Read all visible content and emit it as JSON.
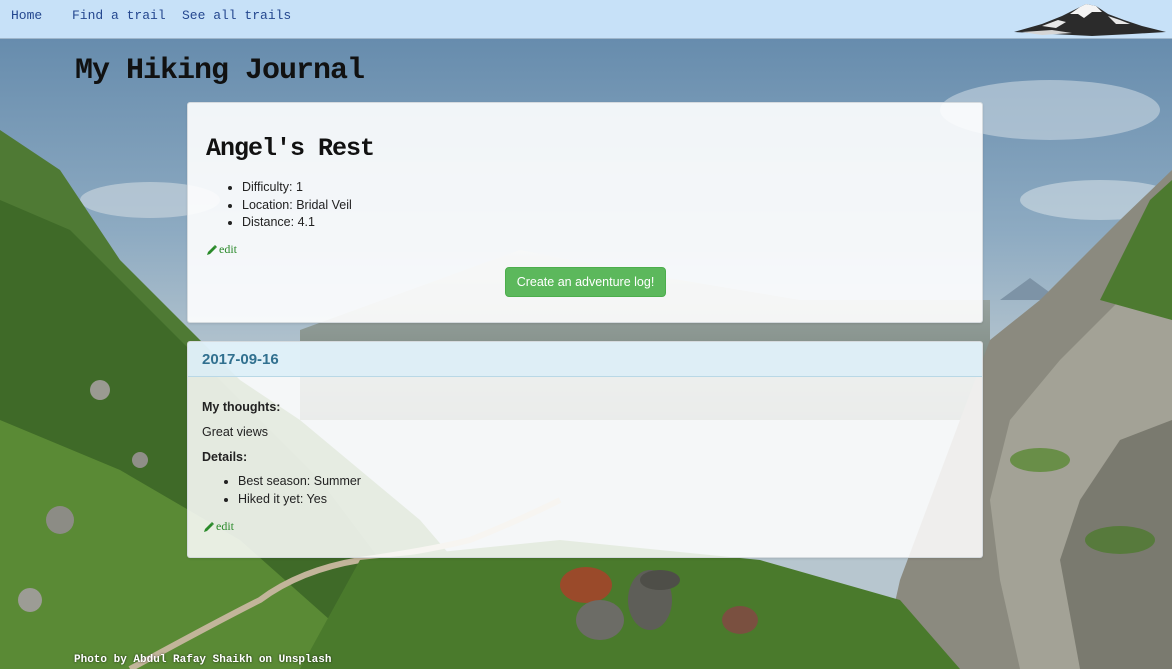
{
  "nav": {
    "home": "Home",
    "find_trail": "Find a trail",
    "all_trails": "See all trails",
    "logo_icon": "mountain-icon"
  },
  "journal_title": "My Hiking Journal",
  "trail": {
    "name": "Angel's Rest",
    "attributes": [
      "Difficulty: 1",
      "Location: Bridal Veil",
      "Distance: 4.1"
    ],
    "edit_label": "edit",
    "create_log_button": "Create an adventure log!"
  },
  "log": {
    "date": "2017-09-16",
    "thoughts_label": "My thoughts:",
    "thoughts_text": "Great views",
    "details_label": "Details:",
    "details": [
      "Best season: Summer",
      "Hiked it yet: Yes"
    ],
    "edit_label": "edit"
  },
  "photo_credit": "Photo by Abdul Rafay Shaikh on Unsplash",
  "colors": {
    "nav_bg": "#c7e1f8",
    "nav_link": "#24478f",
    "button_green": "#5cb85c",
    "edit_green": "#2a8a2a",
    "log_heading_bg": "#d9edf7",
    "log_date": "#31708f"
  }
}
